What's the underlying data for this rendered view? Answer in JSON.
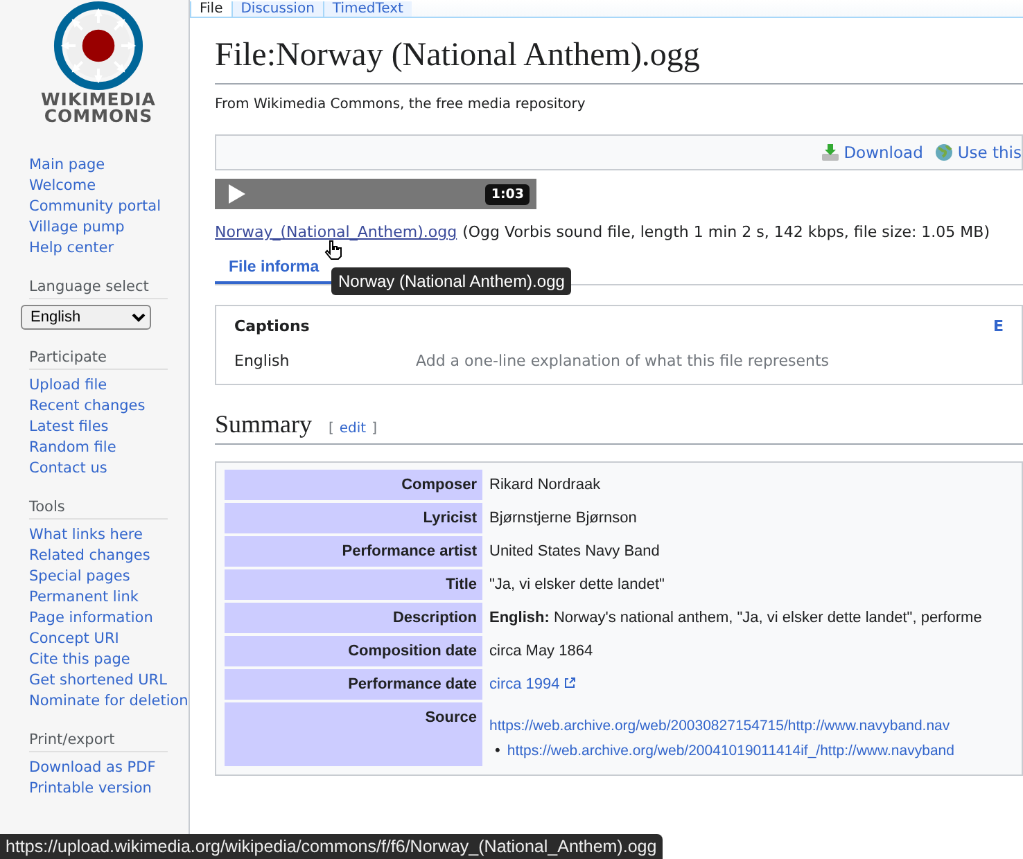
{
  "top_tabs": [
    {
      "label": "File",
      "selected": true
    },
    {
      "label": "Discussion",
      "selected": false
    },
    {
      "label": "TimedText",
      "selected": false
    }
  ],
  "sidebar": {
    "logo_text": [
      "WIKIMEDIA",
      "COMMONS"
    ],
    "nav": [
      "Main page",
      "Welcome",
      "Community portal",
      "Village pump",
      "Help center"
    ],
    "language_select": {
      "heading": "Language select",
      "value": "English"
    },
    "sections": [
      {
        "heading": "Participate",
        "items": [
          "Upload file",
          "Recent changes",
          "Latest files",
          "Random file",
          "Contact us"
        ]
      },
      {
        "heading": "Tools",
        "items": [
          "What links here",
          "Related changes",
          "Special pages",
          "Permanent link",
          "Page information",
          "Concept URI",
          "Cite this page",
          "Get shortened URL",
          "Nominate for deletion"
        ]
      },
      {
        "heading": "Print/export",
        "items": [
          "Download as PDF",
          "Printable version"
        ]
      }
    ]
  },
  "page": {
    "title": "File:Norway (National Anthem).ogg",
    "tagline": "From Wikimedia Commons, the free media repository",
    "toolbar_links": [
      {
        "label": "Download",
        "kind": "download"
      },
      {
        "label": "Use this",
        "kind": "globe"
      }
    ],
    "player": {
      "time": "1:03"
    },
    "file_link": "Norway_(National_Anthem).ogg",
    "file_details": "(Ogg Vorbis sound file, length 1 min 2 s, 142 kbps, file size: 1.05 MB)",
    "tooltip": "Norway (National Anthem).ogg",
    "info_tabs": [
      {
        "label": "File informa",
        "selected": true
      }
    ],
    "captions": {
      "heading": "Captions",
      "edit": "E",
      "rows": [
        {
          "language": "English",
          "placeholder": "Add a one-line explanation of what this file represents"
        }
      ]
    },
    "summary": {
      "heading": "Summary",
      "edit_open": "[",
      "edit": "edit",
      "edit_close": "]"
    },
    "info_table": [
      {
        "label": "Composer",
        "kind": "text",
        "value": "Rikard Nordraak"
      },
      {
        "label": "Lyricist",
        "kind": "text",
        "value": "Bjørnstjerne Bjørnson"
      },
      {
        "label": "Performance artist",
        "kind": "text",
        "value": "United States Navy Band"
      },
      {
        "label": "Title",
        "kind": "text",
        "value": "\"Ja, vi elsker dette landet\""
      },
      {
        "label": "Description",
        "kind": "text",
        "value": "**English:** Norway's national anthem, \"Ja, vi elsker dette landet\", performe"
      },
      {
        "label": "Composition date",
        "kind": "text",
        "value": "circa May 1864"
      },
      {
        "label": "Performance date",
        "kind": "external_link",
        "value": "circa 1994"
      },
      {
        "label": "Source",
        "kind": "links",
        "bullet_mark": "•",
        "value": "https://web.archive.org/web/20030827154715/http://www.navyband.nav",
        "bullets": [
          "https://web.archive.org/web/20041019011414if_/http://www.navyband"
        ]
      }
    ]
  },
  "status_bar": "https://upload.wikimedia.org/wikipedia/commons/f/f6/Norway_(National_Anthem).ogg"
}
